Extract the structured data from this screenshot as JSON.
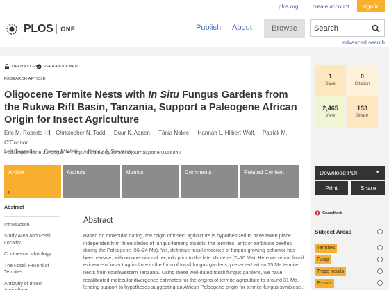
{
  "utility": {
    "site_link": "plos.org",
    "create_account": "create account",
    "sign_in": "sign in"
  },
  "header": {
    "logo_plos": "PLOS",
    "logo_one": "ONE",
    "nav": [
      "Publish",
      "About",
      "Browse"
    ],
    "search_placeholder": "Search",
    "advanced_search": "advanced search"
  },
  "article": {
    "badges": [
      "OPEN ACCESS",
      "PEER-REVIEWED"
    ],
    "type": "RESEARCH ARTICLE",
    "title_part1": "Oligocene Termite Nests with ",
    "title_italic": "In Situ",
    "title_part2": " Fungus Gardens from the Rukwa Rift Basin, Tanzania, Support a Paleogene African Origin for Insect Agriculture",
    "authors_line1": [
      "Eric M. Roberts",
      "Christopher N. Todd,",
      "Duur K. Aanen,",
      "Tânia Nobre,",
      "Hannah L. Hilbert-Wolf,",
      "Patrick M. O'Connor,"
    ],
    "authors_line2": [
      "Leif Tapanila,",
      "Cassy Mtelela,",
      "Nancy J. Stevens"
    ],
    "published": "Published: June 22, 2016",
    "doi": "http://dx.doi.org/10.1371/journal.pone.0156847"
  },
  "tabs": [
    "Article",
    "Authors",
    "Metrics",
    "Comments",
    "Related Content"
  ],
  "sidenav": [
    "Abstract",
    "Introduction",
    "Study Area and Fossil Locality",
    "Continental Ichnology",
    "The Fossil Record of Termites",
    "Antiquity of Insect Agriculture"
  ],
  "abstract": {
    "heading": "Abstract",
    "text": "Based on molecular dating, the origin of insect agriculture is hypothesized to have taken place independently in three clades of fungus-farming insects: the termites, ants or ambrosia beetles during the Paleogene (66–24 Ma). Yet, definitive fossil evidence of fungus-growing behavior has been elusive, with no unequivocal records prior to the late Miocene (7–10 Ma). Here we report fossil evidence of insect agriculture in the form of fossil fungus gardens, preserved within 25 Ma termite nests from southwestern Tanzania. Using these well-dated fossil fungus gardens, we have recalibrated molecular divergence estimates for the origins of termite agriculture to around 31 Ma, lending support to hypotheses suggesting an African Paleogene origin for termite-fungus symbiosis."
  },
  "metrics": [
    {
      "value": "1",
      "label": "Save"
    },
    {
      "value": "0",
      "label": "Citation"
    },
    {
      "value": "2,465",
      "label": "View"
    },
    {
      "value": "153",
      "label": "Share"
    }
  ],
  "actions": {
    "download": "Download PDF",
    "print": "Print",
    "share": "Share"
  },
  "crossmark": "CrossMark",
  "subject_areas": {
    "heading": "Subject Areas",
    "items": [
      "Termites",
      "Fungi",
      "Trace fossils",
      "Fossils"
    ]
  },
  "colors": {
    "accent": "#f8af2d",
    "link": "#3c63af",
    "metric_light": "#fde7bf",
    "metric_pale": "#fef1d8",
    "metric_green": "#f1f5d3",
    "tab_grey": "#8c8c8c"
  }
}
